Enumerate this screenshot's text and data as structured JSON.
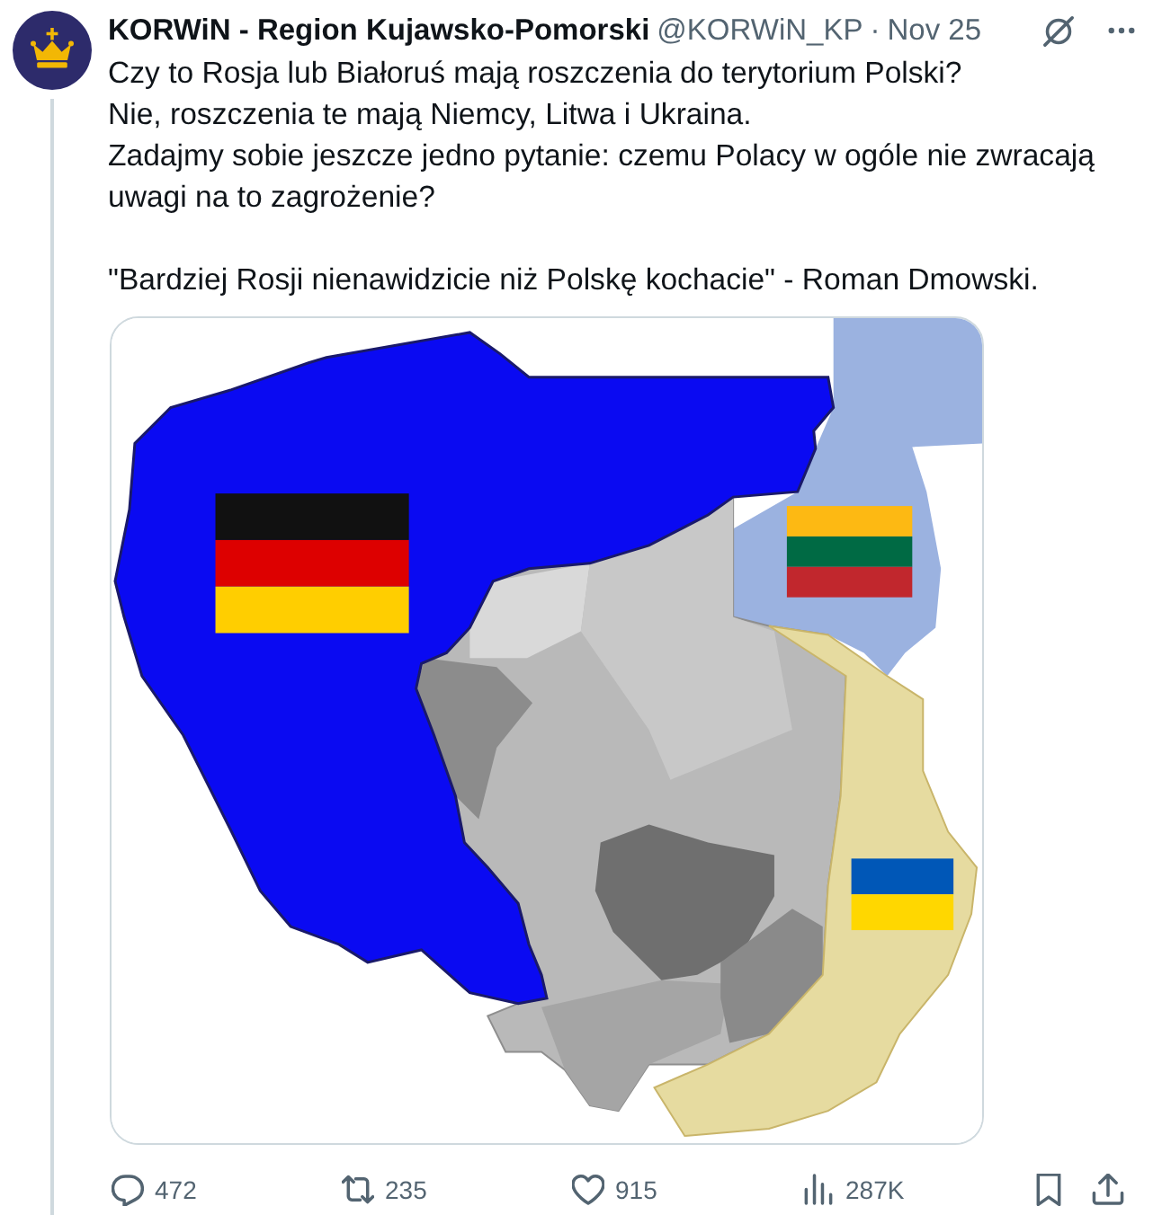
{
  "post": {
    "author": {
      "name": "KORWiN - Region Kujawsko-Pomorski",
      "handle": "@KORWiN_KP",
      "separator": "·",
      "date": "Nov 25"
    },
    "text": "Czy to Rosja lub Białoruś mają roszczenia do terytorium Polski?\nNie, roszczenia te mają Niemcy, Litwa i Ukraina.\nZadajmy sobie jeszcze jedno pytanie: czemu Polacy w ogóle nie zwracają uwagi na to zagrożenie?\n\n\"Bardziej Rosji nienawidzicie niż Polskę kochacie\" - Roman Dmowski.",
    "media": [
      {
        "kind": "map"
      }
    ],
    "actions": [
      {
        "kind": "reply",
        "count": "472"
      },
      {
        "kind": "repost",
        "count": "235"
      },
      {
        "kind": "like",
        "count": "915"
      },
      {
        "kind": "views",
        "count": "287K"
      },
      {
        "kind": "bookmark"
      },
      {
        "kind": "share"
      }
    ]
  }
}
